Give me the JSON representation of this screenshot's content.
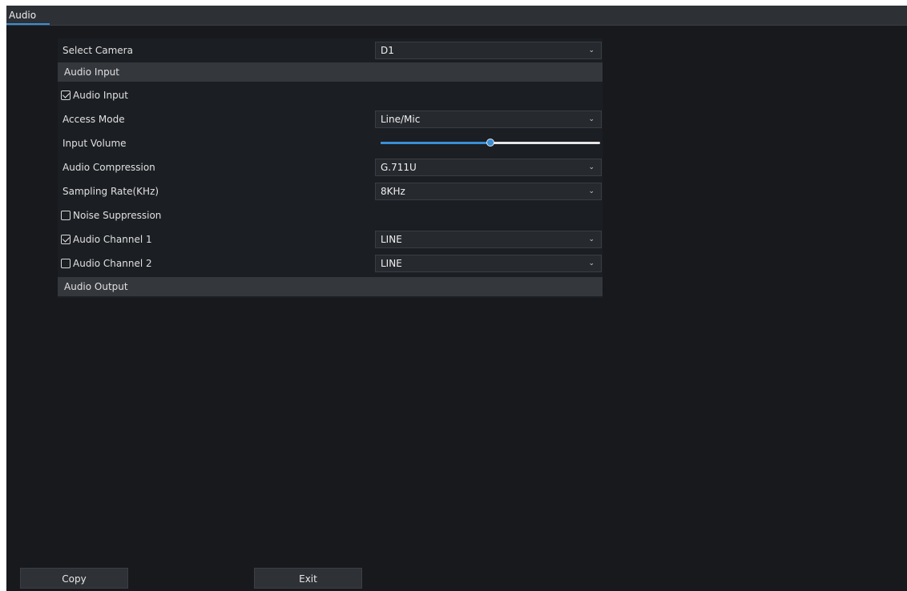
{
  "tabs": [
    {
      "label": "Audio",
      "active": true
    }
  ],
  "form": {
    "select_camera": {
      "label": "Select Camera",
      "value": "D1"
    },
    "audio_input_section": "Audio Input",
    "audio_input_enable": {
      "label": "Audio Input",
      "checked": true
    },
    "access_mode": {
      "label": "Access Mode",
      "value": "Line/Mic"
    },
    "input_volume": {
      "label": "Input Volume",
      "level_fraction": 0.5
    },
    "audio_compression": {
      "label": "Audio Compression",
      "value": "G.711U"
    },
    "sampling_rate": {
      "label": "Sampling Rate(KHz)",
      "value": "8KHz"
    },
    "noise_suppression": {
      "label": "Noise Suppression",
      "checked": false
    },
    "audio_channel_1": {
      "label": "Audio Channel 1",
      "checked": true,
      "value": "LINE"
    },
    "audio_channel_2": {
      "label": "Audio Channel 2",
      "checked": false,
      "value": "LINE"
    },
    "audio_output_section": "Audio Output"
  },
  "footer": {
    "copy_label": "Copy",
    "exit_label": "Exit"
  },
  "colors": {
    "accent": "#3b8fd6",
    "background": "#17191d",
    "section": "#34373c"
  },
  "icons": {
    "dropdown": "chevron-down-icon",
    "checkbox": "checkbox-icon"
  }
}
